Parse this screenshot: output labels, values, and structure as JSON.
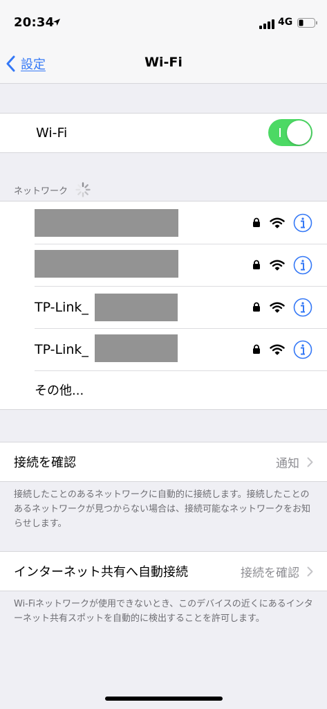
{
  "status_bar": {
    "time": "20:34",
    "network": "4G"
  },
  "nav": {
    "back_label": "設定",
    "title": "Wi-Fi"
  },
  "wifi_toggle": {
    "label": "Wi-Fi",
    "on": true,
    "accent": "#4cd964"
  },
  "networks_section": {
    "header": "ネットワーク"
  },
  "networks": [
    {
      "name": "",
      "redacted": true,
      "locked": true
    },
    {
      "name": "",
      "redacted": true,
      "locked": true
    },
    {
      "name": "TP-Link_",
      "redacted": true,
      "locked": true
    },
    {
      "name": "TP-Link_",
      "redacted": true,
      "locked": true
    }
  ],
  "other_label": "その他...",
  "ask_to_join": {
    "label": "接続を確認",
    "value": "通知",
    "footnote": "接続したことのあるネットワークに自動的に接続します。接続したことのあるネットワークが見つからない場合は、接続可能なネットワークをお知らせします。"
  },
  "hotspot": {
    "label": "インターネット共有へ自動接続",
    "value": "接続を確認",
    "footnote": "Wi-Fiネットワークが使用できないとき、このデバイスの近くにあるインターネット共有スポットを自動的に検出することを許可します。"
  },
  "colors": {
    "link": "#3478f6",
    "secondary": "#8e8e93",
    "background": "#efeff4"
  }
}
